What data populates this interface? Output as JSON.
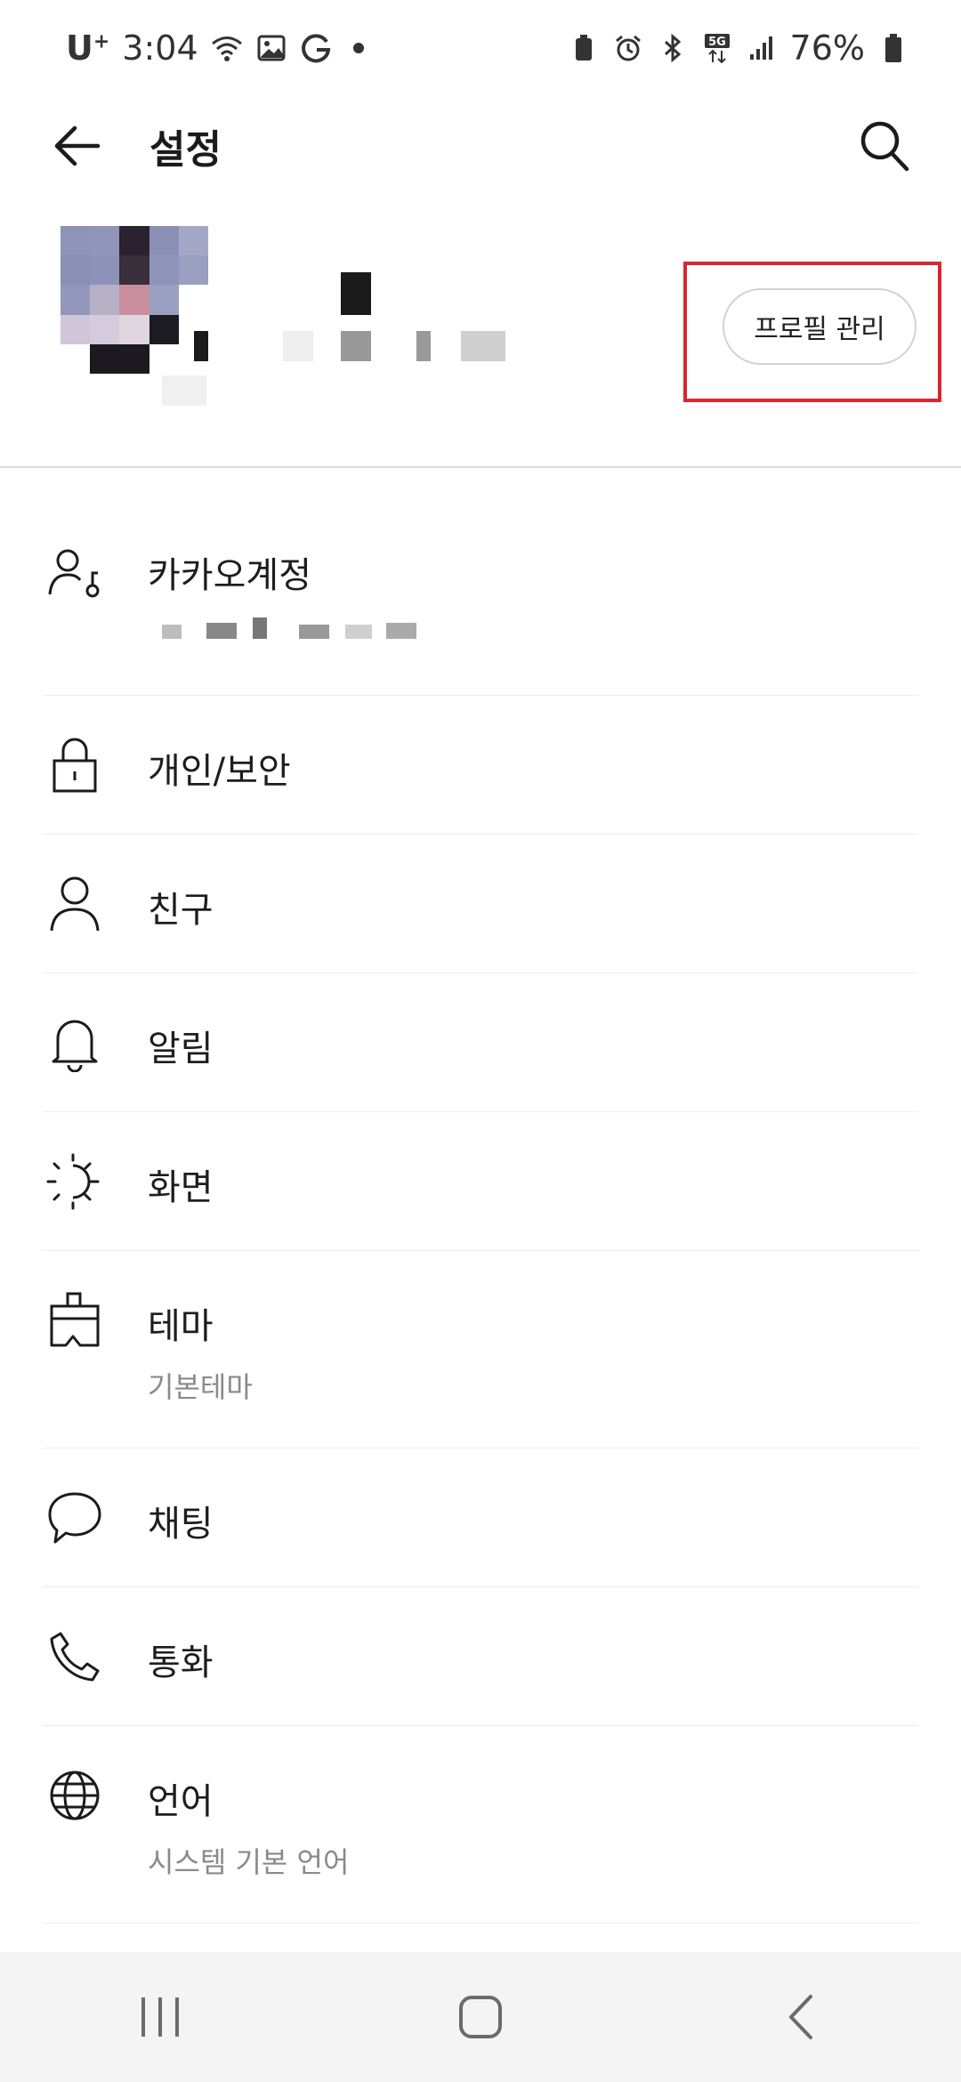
{
  "status_bar": {
    "carrier": "U",
    "carrier_sup": "+",
    "time": "3:04",
    "battery": "76%"
  },
  "header": {
    "title": "설정"
  },
  "profile": {
    "manage_button": "프로필 관리"
  },
  "menu": [
    {
      "label": "카카오계정",
      "sub": "",
      "icon": "account-key-icon"
    },
    {
      "label": "개인/보안",
      "sub": "",
      "icon": "lock-icon"
    },
    {
      "label": "친구",
      "sub": "",
      "icon": "person-icon"
    },
    {
      "label": "알림",
      "sub": "",
      "icon": "bell-icon"
    },
    {
      "label": "화면",
      "sub": "",
      "icon": "brightness-icon"
    },
    {
      "label": "테마",
      "sub": "기본테마",
      "icon": "theme-brush-icon"
    },
    {
      "label": "채팅",
      "sub": "",
      "icon": "chat-bubble-icon"
    },
    {
      "label": "통화",
      "sub": "",
      "icon": "phone-icon"
    },
    {
      "label": "언어",
      "sub": "시스템 기본 언어",
      "icon": "globe-icon"
    }
  ],
  "colors": {
    "highlight": "#d9262f",
    "divider": "#dcdcdc",
    "nav_bg": "#f4f4f4"
  }
}
